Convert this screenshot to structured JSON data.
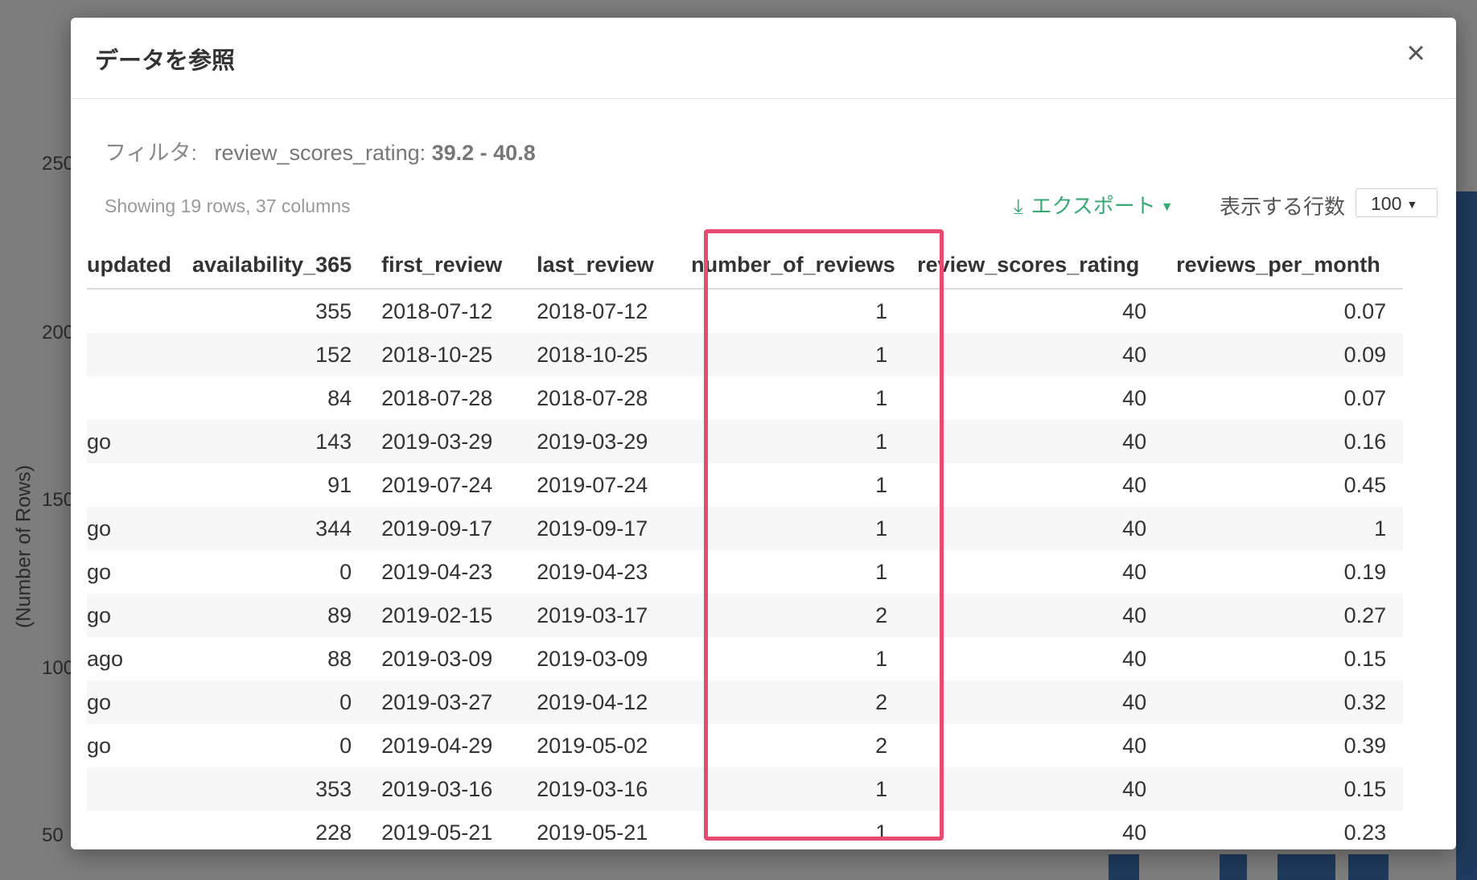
{
  "background_chart": {
    "ylabel": "(Number of Rows)",
    "ticks": [
      "250",
      "200",
      "150",
      "100",
      "50"
    ],
    "bar_color": "#1f3a5c"
  },
  "modal": {
    "title": "データを参照",
    "close_icon": "close-icon",
    "filter": {
      "label": "フィルタ:",
      "column": "review_scores_rating:",
      "range": "39.2 - 40.8"
    },
    "showing": "Showing 19 rows, 37 columns",
    "export_label": "エクスポート",
    "rows_label": "表示する行数",
    "rows_value": "100",
    "accent_color": "#3aa776",
    "highlight_color": "#e84a72"
  },
  "table": {
    "columns": [
      "updated",
      "availability_365",
      "first_review",
      "last_review",
      "number_of_reviews",
      "review_scores_rating",
      "reviews_per_month"
    ],
    "rows": [
      [
        "",
        "355",
        "2018-07-12",
        "2018-07-12",
        "1",
        "40",
        "0.07"
      ],
      [
        "",
        "152",
        "2018-10-25",
        "2018-10-25",
        "1",
        "40",
        "0.09"
      ],
      [
        "",
        "84",
        "2018-07-28",
        "2018-07-28",
        "1",
        "40",
        "0.07"
      ],
      [
        "go",
        "143",
        "2019-03-29",
        "2019-03-29",
        "1",
        "40",
        "0.16"
      ],
      [
        "",
        "91",
        "2019-07-24",
        "2019-07-24",
        "1",
        "40",
        "0.45"
      ],
      [
        "go",
        "344",
        "2019-09-17",
        "2019-09-17",
        "1",
        "40",
        "1"
      ],
      [
        "go",
        "0",
        "2019-04-23",
        "2019-04-23",
        "1",
        "40",
        "0.19"
      ],
      [
        "go",
        "89",
        "2019-02-15",
        "2019-03-17",
        "2",
        "40",
        "0.27"
      ],
      [
        "ago",
        "88",
        "2019-03-09",
        "2019-03-09",
        "1",
        "40",
        "0.15"
      ],
      [
        "go",
        "0",
        "2019-03-27",
        "2019-04-12",
        "2",
        "40",
        "0.32"
      ],
      [
        "go",
        "0",
        "2019-04-29",
        "2019-05-02",
        "2",
        "40",
        "0.39"
      ],
      [
        "",
        "353",
        "2019-03-16",
        "2019-03-16",
        "1",
        "40",
        "0.15"
      ],
      [
        "",
        "228",
        "2019-05-21",
        "2019-05-21",
        "1",
        "40",
        "0.23"
      ]
    ]
  }
}
